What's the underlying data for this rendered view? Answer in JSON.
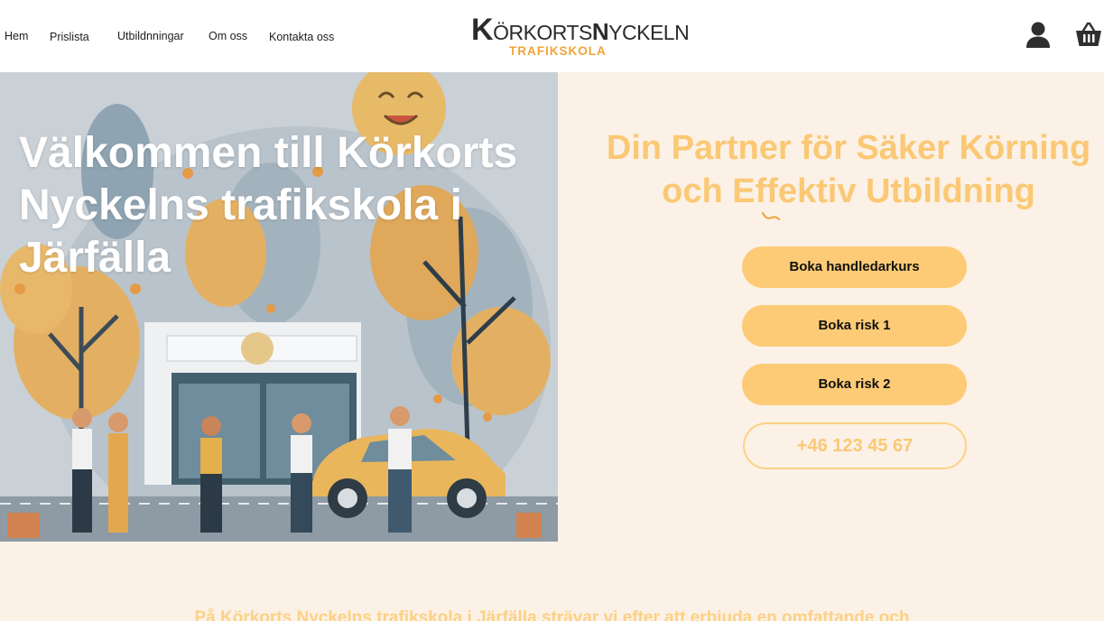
{
  "nav": {
    "items": [
      {
        "label": "Hem"
      },
      {
        "label": "Prislista"
      },
      {
        "label": "Utbildnningar"
      },
      {
        "label": "Om oss"
      },
      {
        "label": "Kontakta oss"
      }
    ]
  },
  "logo": {
    "main_k": "K",
    "main_rest1": "ÖRKORTS",
    "main_n": "N",
    "main_rest2": "YCKELN",
    "sub": "TRAFIKSKOLA"
  },
  "header_icons": {
    "account": "user-icon",
    "cart": "basket-icon"
  },
  "hero": {
    "title": "Välkommen till Körkorts Nyckelns trafikskola i Järfälla"
  },
  "right": {
    "title_line1": "Din Partner för Säker Körning",
    "title_line2": "och Effektiv Utbildning",
    "buttons": [
      {
        "label": "Boka handledarkurs"
      },
      {
        "label": "Boka risk 1"
      },
      {
        "label": "Boka risk 2"
      }
    ],
    "phone": "+46 123 45 67"
  },
  "intro": {
    "text": "På Körkorts Nyckelns trafikskola i Järfälla strävar vi efter att erbjuda en omfattande och"
  },
  "colors": {
    "accent": "#fdcb76",
    "accent_text": "#fbc874",
    "background": "#fbf1e6",
    "logo_sub": "#f2a33a"
  }
}
